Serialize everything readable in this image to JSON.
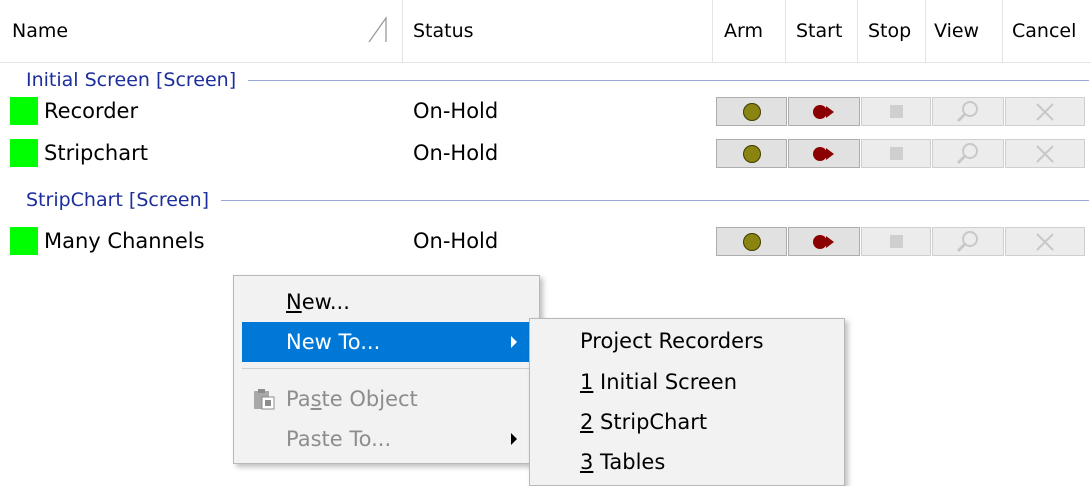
{
  "columns": {
    "name": "Name",
    "status": "Status",
    "arm": "Arm",
    "start": "Start",
    "stop": "Stop",
    "view": "View",
    "cancel": "Cancel"
  },
  "groups": [
    {
      "label": "Initial Screen [Screen]",
      "items": [
        {
          "name": "Recorder",
          "status": "On-Hold",
          "color": "#00ff00"
        },
        {
          "name": "Stripchart",
          "status": "On-Hold",
          "color": "#00ff00"
        }
      ]
    },
    {
      "label": "StripChart [Screen]",
      "items": [
        {
          "name": "Many Channels",
          "status": "On-Hold",
          "color": "#00ff00"
        }
      ]
    }
  ],
  "context_menu": {
    "new": {
      "mnemonic": "N",
      "rest": "ew..."
    },
    "new_to": {
      "mnemonic": "",
      "rest": "New To..."
    },
    "paste_object": {
      "pre": "Pa",
      "mnemonic": "s",
      "rest": "te Object"
    },
    "paste_to": "Paste To..."
  },
  "submenu": {
    "project_recorders": "Project Recorders",
    "items": [
      {
        "mnemonic": "1",
        "rest": " Initial Screen"
      },
      {
        "mnemonic": "2",
        "rest": " StripChart"
      },
      {
        "mnemonic": "3",
        "rest": " Tables"
      }
    ]
  },
  "colors": {
    "accent": "#0078d7",
    "group_text": "#1c2e9b",
    "status_green": "#00ff00",
    "arm": "#8a8410",
    "start": "#8b0000"
  }
}
